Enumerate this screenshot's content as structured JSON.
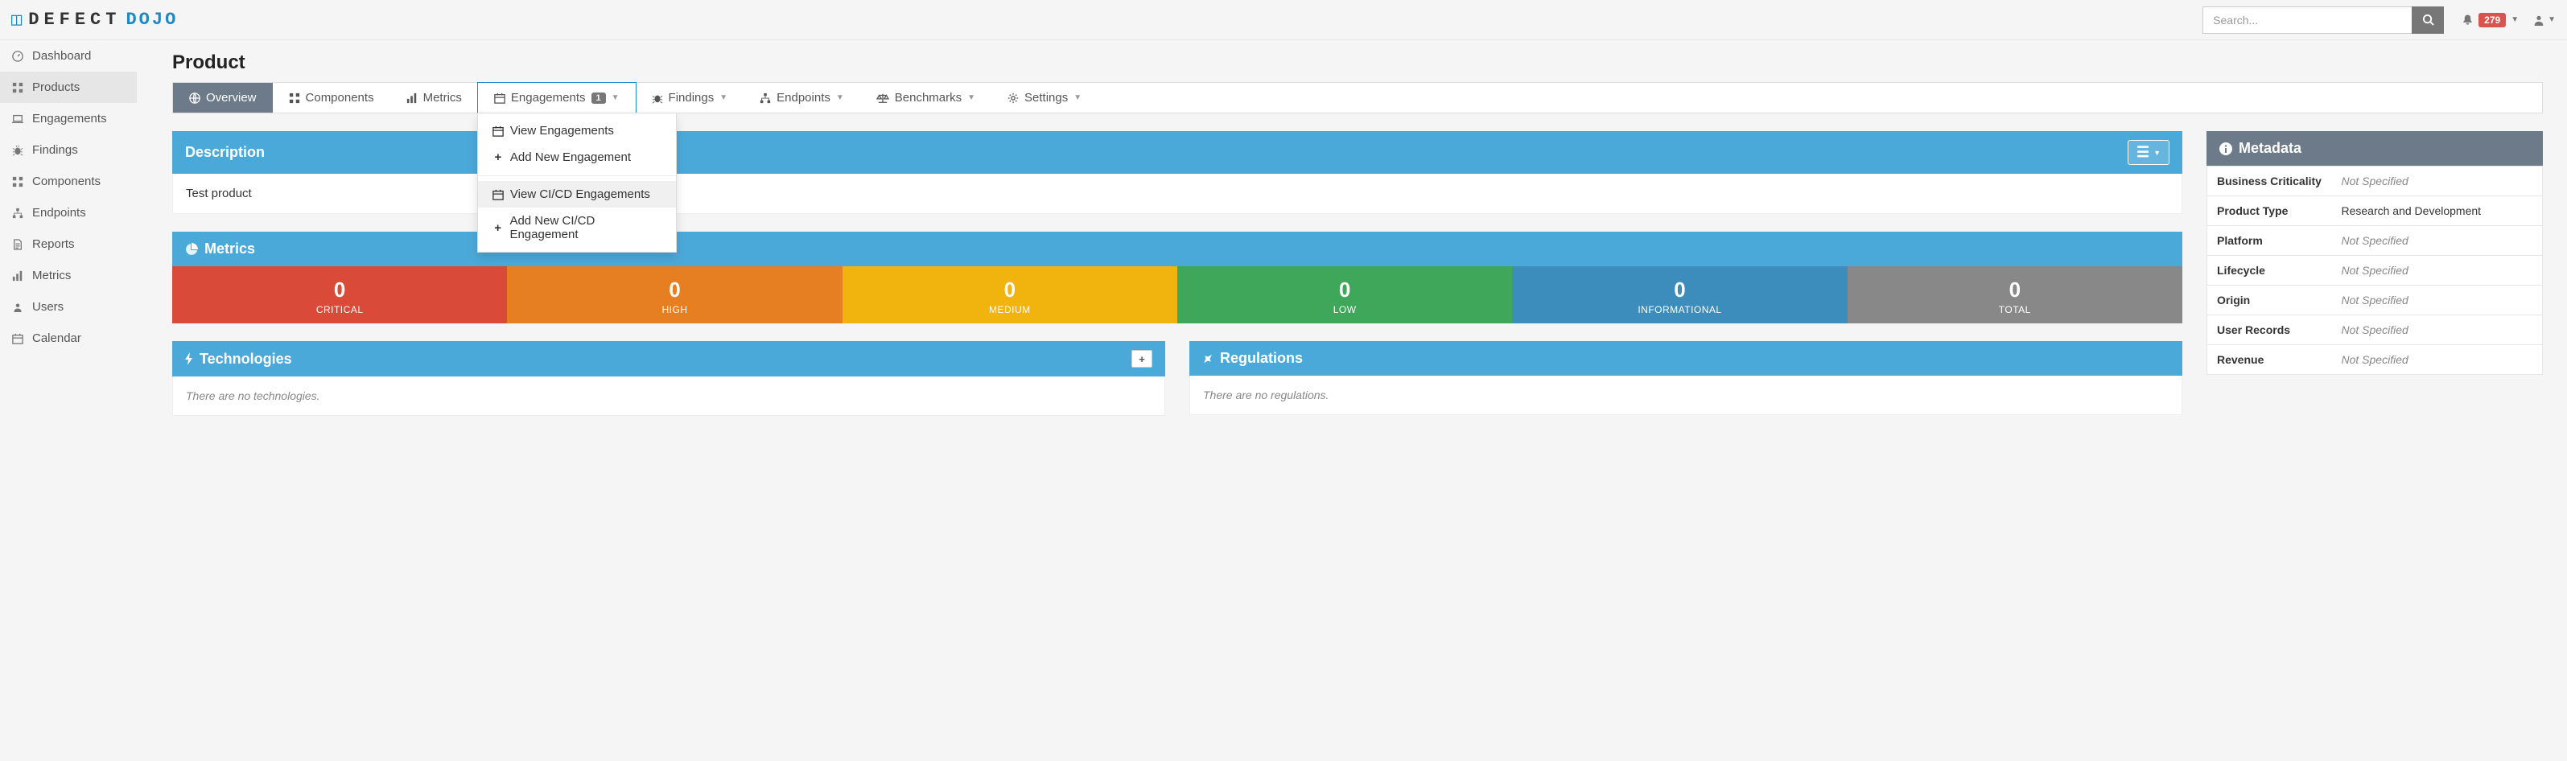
{
  "app": {
    "logo_prefix": "◫",
    "logo_mid": "DEFECT",
    "logo_suffix": "DOJO"
  },
  "topbar": {
    "search_placeholder": "Search...",
    "notif_count": "279"
  },
  "sidebar": {
    "items": [
      {
        "label": "Dashboard"
      },
      {
        "label": "Products"
      },
      {
        "label": "Engagements"
      },
      {
        "label": "Findings"
      },
      {
        "label": "Components"
      },
      {
        "label": "Endpoints"
      },
      {
        "label": "Reports"
      },
      {
        "label": "Metrics"
      },
      {
        "label": "Users"
      },
      {
        "label": "Calendar"
      }
    ]
  },
  "page": {
    "title": "Product"
  },
  "tabs": {
    "overview": "Overview",
    "components": "Components",
    "metrics": "Metrics",
    "engagements": "Engagements",
    "engagements_badge": "1",
    "findings": "Findings",
    "endpoints": "Endpoints",
    "benchmarks": "Benchmarks",
    "settings": "Settings"
  },
  "engagements_menu": {
    "view": "View Engagements",
    "add": "Add New Engagement",
    "view_cicd": "View CI/CD Engagements",
    "add_cicd": "Add New CI/CD Engagement"
  },
  "description": {
    "header": "Description",
    "body": "Test product"
  },
  "metrics": {
    "header": "Metrics",
    "items": [
      {
        "value": "0",
        "label": "CRITICAL"
      },
      {
        "value": "0",
        "label": "HIGH"
      },
      {
        "value": "0",
        "label": "MEDIUM"
      },
      {
        "value": "0",
        "label": "LOW"
      },
      {
        "value": "0",
        "label": "INFORMATIONAL"
      },
      {
        "value": "0",
        "label": "TOTAL"
      }
    ]
  },
  "technologies": {
    "header": "Technologies",
    "empty": "There are no technologies."
  },
  "regulations": {
    "header": "Regulations",
    "empty": "There are no regulations."
  },
  "metadata": {
    "header": "Metadata",
    "rows": [
      {
        "label": "Business Criticality",
        "value": "Not Specified",
        "notspec": true
      },
      {
        "label": "Product Type",
        "value": "Research and Development",
        "notspec": false
      },
      {
        "label": "Platform",
        "value": "Not Specified",
        "notspec": true
      },
      {
        "label": "Lifecycle",
        "value": "Not Specified",
        "notspec": true
      },
      {
        "label": "Origin",
        "value": "Not Specified",
        "notspec": true
      },
      {
        "label": "User Records",
        "value": "Not Specified",
        "notspec": true
      },
      {
        "label": "Revenue",
        "value": "Not Specified",
        "notspec": true
      }
    ]
  }
}
